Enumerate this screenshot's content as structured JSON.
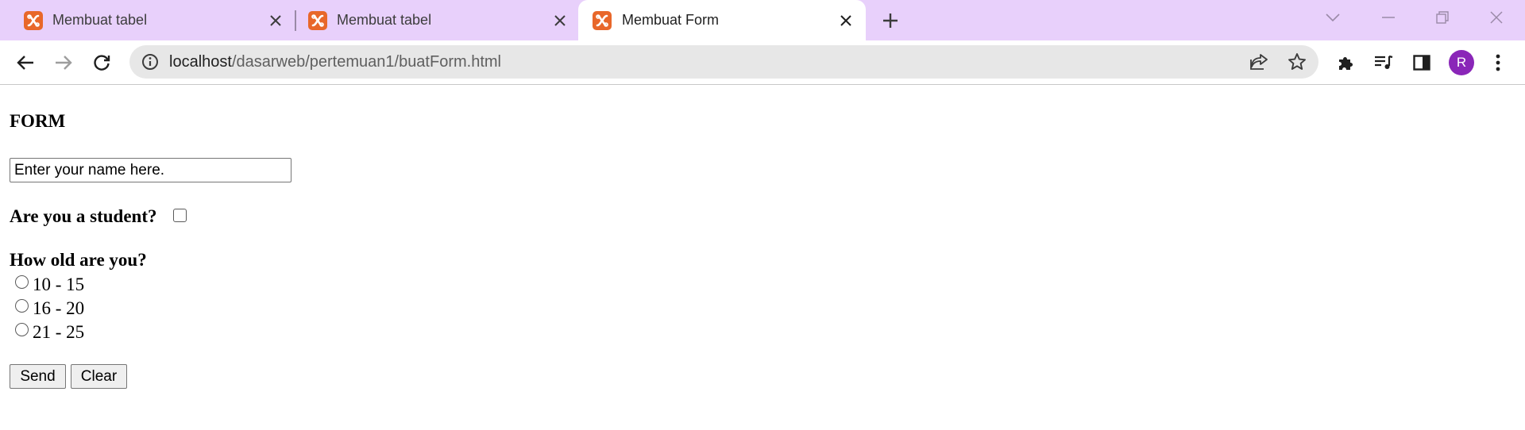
{
  "tabs": [
    {
      "title": "Membuat tabel",
      "active": false
    },
    {
      "title": "Membuat tabel",
      "active": false
    },
    {
      "title": "Membuat Form",
      "active": true
    }
  ],
  "address_bar": {
    "url_host": "localhost",
    "url_path": "/dasarweb/pertemuan1/buatForm.html"
  },
  "profile": {
    "initial": "R",
    "color": "#8a26b8"
  },
  "colors": {
    "tabstrip": "#e8d0fb",
    "favicon": "#e8672a"
  },
  "page": {
    "heading": "FORM",
    "name_field": {
      "value": "Enter your name here."
    },
    "student_question": "Are you a student?",
    "student_checked": false,
    "age_question": "How old are you?",
    "age_options": [
      "10 - 15",
      "16 - 20",
      "21 - 25"
    ],
    "send_label": "Send",
    "clear_label": "Clear"
  }
}
